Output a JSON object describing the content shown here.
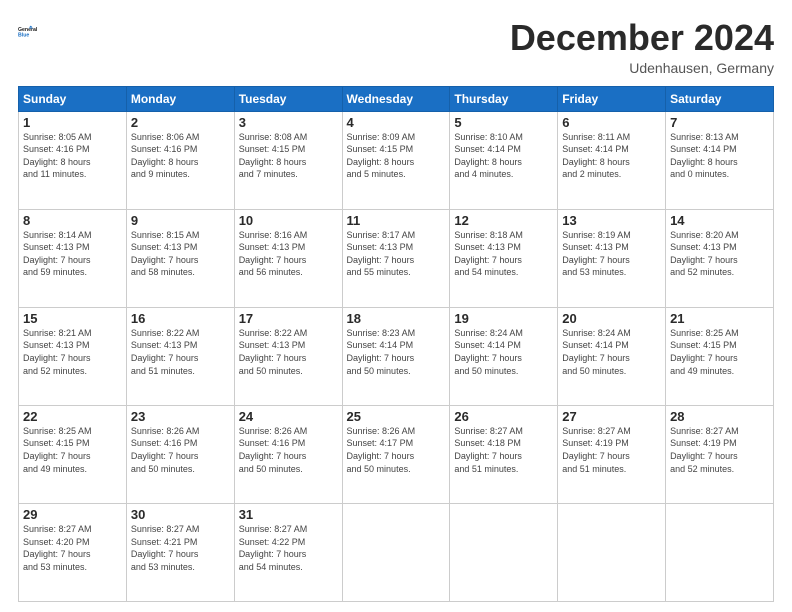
{
  "header": {
    "logo_line1": "General",
    "logo_line2": "Blue",
    "month": "December 2024",
    "location": "Udenhausen, Germany"
  },
  "days_of_week": [
    "Sunday",
    "Monday",
    "Tuesday",
    "Wednesday",
    "Thursday",
    "Friday",
    "Saturday"
  ],
  "weeks": [
    [
      {
        "day": "1",
        "info": "Sunrise: 8:05 AM\nSunset: 4:16 PM\nDaylight: 8 hours\nand 11 minutes."
      },
      {
        "day": "2",
        "info": "Sunrise: 8:06 AM\nSunset: 4:16 PM\nDaylight: 8 hours\nand 9 minutes."
      },
      {
        "day": "3",
        "info": "Sunrise: 8:08 AM\nSunset: 4:15 PM\nDaylight: 8 hours\nand 7 minutes."
      },
      {
        "day": "4",
        "info": "Sunrise: 8:09 AM\nSunset: 4:15 PM\nDaylight: 8 hours\nand 5 minutes."
      },
      {
        "day": "5",
        "info": "Sunrise: 8:10 AM\nSunset: 4:14 PM\nDaylight: 8 hours\nand 4 minutes."
      },
      {
        "day": "6",
        "info": "Sunrise: 8:11 AM\nSunset: 4:14 PM\nDaylight: 8 hours\nand 2 minutes."
      },
      {
        "day": "7",
        "info": "Sunrise: 8:13 AM\nSunset: 4:14 PM\nDaylight: 8 hours\nand 0 minutes."
      }
    ],
    [
      {
        "day": "8",
        "info": "Sunrise: 8:14 AM\nSunset: 4:13 PM\nDaylight: 7 hours\nand 59 minutes."
      },
      {
        "day": "9",
        "info": "Sunrise: 8:15 AM\nSunset: 4:13 PM\nDaylight: 7 hours\nand 58 minutes."
      },
      {
        "day": "10",
        "info": "Sunrise: 8:16 AM\nSunset: 4:13 PM\nDaylight: 7 hours\nand 56 minutes."
      },
      {
        "day": "11",
        "info": "Sunrise: 8:17 AM\nSunset: 4:13 PM\nDaylight: 7 hours\nand 55 minutes."
      },
      {
        "day": "12",
        "info": "Sunrise: 8:18 AM\nSunset: 4:13 PM\nDaylight: 7 hours\nand 54 minutes."
      },
      {
        "day": "13",
        "info": "Sunrise: 8:19 AM\nSunset: 4:13 PM\nDaylight: 7 hours\nand 53 minutes."
      },
      {
        "day": "14",
        "info": "Sunrise: 8:20 AM\nSunset: 4:13 PM\nDaylight: 7 hours\nand 52 minutes."
      }
    ],
    [
      {
        "day": "15",
        "info": "Sunrise: 8:21 AM\nSunset: 4:13 PM\nDaylight: 7 hours\nand 52 minutes."
      },
      {
        "day": "16",
        "info": "Sunrise: 8:22 AM\nSunset: 4:13 PM\nDaylight: 7 hours\nand 51 minutes."
      },
      {
        "day": "17",
        "info": "Sunrise: 8:22 AM\nSunset: 4:13 PM\nDaylight: 7 hours\nand 50 minutes."
      },
      {
        "day": "18",
        "info": "Sunrise: 8:23 AM\nSunset: 4:14 PM\nDaylight: 7 hours\nand 50 minutes."
      },
      {
        "day": "19",
        "info": "Sunrise: 8:24 AM\nSunset: 4:14 PM\nDaylight: 7 hours\nand 50 minutes."
      },
      {
        "day": "20",
        "info": "Sunrise: 8:24 AM\nSunset: 4:14 PM\nDaylight: 7 hours\nand 50 minutes."
      },
      {
        "day": "21",
        "info": "Sunrise: 8:25 AM\nSunset: 4:15 PM\nDaylight: 7 hours\nand 49 minutes."
      }
    ],
    [
      {
        "day": "22",
        "info": "Sunrise: 8:25 AM\nSunset: 4:15 PM\nDaylight: 7 hours\nand 49 minutes."
      },
      {
        "day": "23",
        "info": "Sunrise: 8:26 AM\nSunset: 4:16 PM\nDaylight: 7 hours\nand 50 minutes."
      },
      {
        "day": "24",
        "info": "Sunrise: 8:26 AM\nSunset: 4:16 PM\nDaylight: 7 hours\nand 50 minutes."
      },
      {
        "day": "25",
        "info": "Sunrise: 8:26 AM\nSunset: 4:17 PM\nDaylight: 7 hours\nand 50 minutes."
      },
      {
        "day": "26",
        "info": "Sunrise: 8:27 AM\nSunset: 4:18 PM\nDaylight: 7 hours\nand 51 minutes."
      },
      {
        "day": "27",
        "info": "Sunrise: 8:27 AM\nSunset: 4:19 PM\nDaylight: 7 hours\nand 51 minutes."
      },
      {
        "day": "28",
        "info": "Sunrise: 8:27 AM\nSunset: 4:19 PM\nDaylight: 7 hours\nand 52 minutes."
      }
    ],
    [
      {
        "day": "29",
        "info": "Sunrise: 8:27 AM\nSunset: 4:20 PM\nDaylight: 7 hours\nand 53 minutes."
      },
      {
        "day": "30",
        "info": "Sunrise: 8:27 AM\nSunset: 4:21 PM\nDaylight: 7 hours\nand 53 minutes."
      },
      {
        "day": "31",
        "info": "Sunrise: 8:27 AM\nSunset: 4:22 PM\nDaylight: 7 hours\nand 54 minutes."
      },
      {
        "day": "",
        "info": ""
      },
      {
        "day": "",
        "info": ""
      },
      {
        "day": "",
        "info": ""
      },
      {
        "day": "",
        "info": ""
      }
    ]
  ]
}
